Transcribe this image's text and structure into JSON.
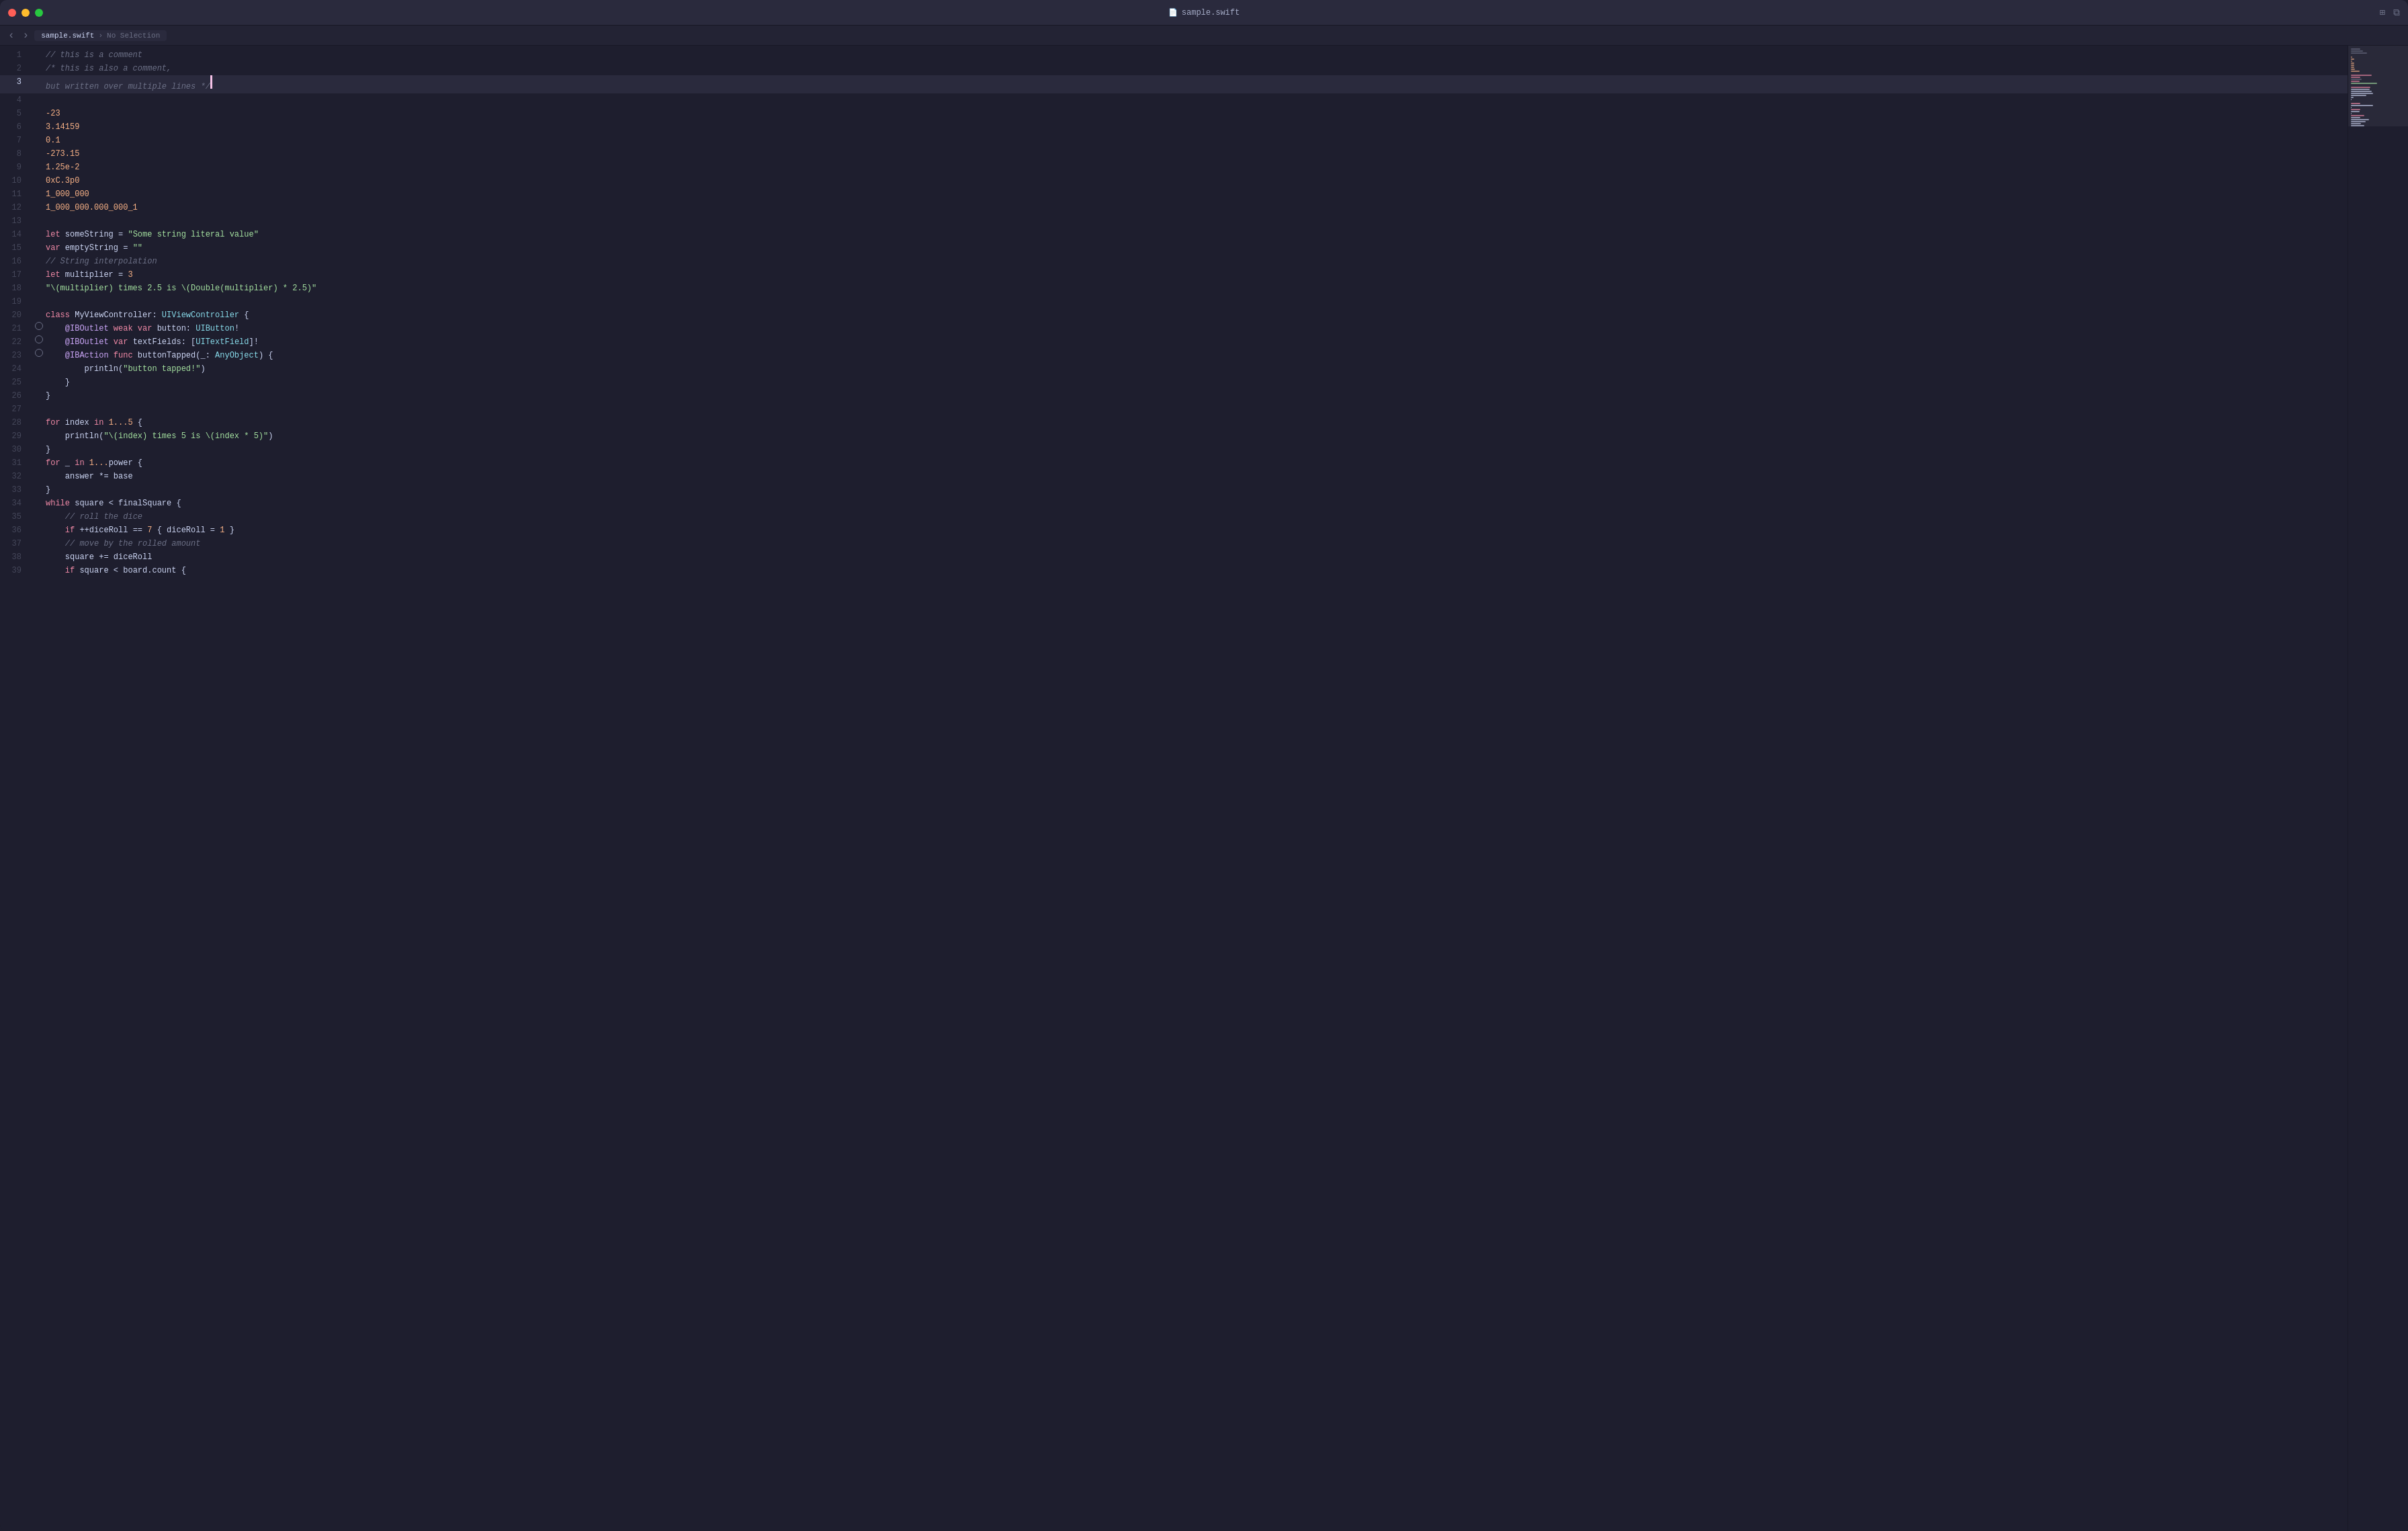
{
  "window": {
    "title": "sample.swift",
    "tab_label": "sample.swift",
    "breadcrumb": "No Selection",
    "traffic_lights": {
      "close": "close",
      "minimize": "minimize",
      "maximize": "maximize"
    }
  },
  "toolbar": {
    "nav_back": "‹",
    "nav_forward": "›",
    "grid_icon": "⊞",
    "split_icon": "⧉"
  },
  "code": {
    "lines": [
      {
        "num": 1,
        "gutter": "",
        "content": "// this is a comment",
        "tokens": [
          {
            "type": "comment",
            "text": "// this is a comment"
          }
        ]
      },
      {
        "num": 2,
        "gutter": "",
        "content": "/* this is also a comment,",
        "tokens": [
          {
            "type": "comment",
            "text": "/* this is also a comment,"
          }
        ]
      },
      {
        "num": 3,
        "gutter": "",
        "content": "but written over multiple lines */",
        "tokens": [
          {
            "type": "comment",
            "text": "but written over multiple lines */"
          }
        ],
        "active": true
      },
      {
        "num": 4,
        "gutter": "",
        "content": "",
        "tokens": []
      },
      {
        "num": 5,
        "gutter": "",
        "content": "-23",
        "tokens": [
          {
            "type": "number",
            "text": "-23"
          }
        ]
      },
      {
        "num": 6,
        "gutter": "",
        "content": "3.14159",
        "tokens": [
          {
            "type": "number",
            "text": "3.14159"
          }
        ]
      },
      {
        "num": 7,
        "gutter": "",
        "content": "0.1",
        "tokens": [
          {
            "type": "number",
            "text": "0.1"
          }
        ]
      },
      {
        "num": 8,
        "gutter": "",
        "content": "-273.15",
        "tokens": [
          {
            "type": "number",
            "text": "-273.15"
          }
        ]
      },
      {
        "num": 9,
        "gutter": "",
        "content": "1.25e-2",
        "tokens": [
          {
            "type": "number",
            "text": "1.25e-2"
          }
        ]
      },
      {
        "num": 10,
        "gutter": "",
        "content": "0xC.3p0",
        "tokens": [
          {
            "type": "number",
            "text": "0xC.3p0"
          }
        ]
      },
      {
        "num": 11,
        "gutter": "",
        "content": "1_000_000",
        "tokens": [
          {
            "type": "number",
            "text": "1_000_000"
          }
        ]
      },
      {
        "num": 12,
        "gutter": "",
        "content": "1_000_000.000_000_1",
        "tokens": [
          {
            "type": "number",
            "text": "1_000_000.000_000_1"
          }
        ]
      },
      {
        "num": 13,
        "gutter": "",
        "content": "",
        "tokens": []
      },
      {
        "num": 14,
        "gutter": "",
        "content": "let someString = \"Some string literal value\"",
        "tokens": [
          {
            "type": "keyword",
            "text": "let"
          },
          {
            "type": "plain",
            "text": " someString = "
          },
          {
            "type": "string",
            "text": "\"Some string literal value\""
          }
        ]
      },
      {
        "num": 15,
        "gutter": "",
        "content": "var emptyString = \"\"",
        "tokens": [
          {
            "type": "keyword",
            "text": "var"
          },
          {
            "type": "plain",
            "text": " emptyString = "
          },
          {
            "type": "string",
            "text": "\"\""
          }
        ]
      },
      {
        "num": 16,
        "gutter": "",
        "content": "// String interpolation",
        "tokens": [
          {
            "type": "comment",
            "text": "// String interpolation"
          }
        ]
      },
      {
        "num": 17,
        "gutter": "",
        "content": "let multiplier = 3",
        "tokens": [
          {
            "type": "keyword",
            "text": "let"
          },
          {
            "type": "plain",
            "text": " multiplier = "
          },
          {
            "type": "number",
            "text": "3"
          }
        ]
      },
      {
        "num": 18,
        "gutter": "",
        "content": "\"\\(multiplier) times 2.5 is \\(Double(multiplier) * 2.5)\"",
        "tokens": [
          {
            "type": "string",
            "text": "\"\\(multiplier) times 2.5 is \\(Double(multiplier) * 2.5)\""
          }
        ]
      },
      {
        "num": 19,
        "gutter": "",
        "content": "",
        "tokens": []
      },
      {
        "num": 20,
        "gutter": "",
        "content": "class MyViewController: UIViewController {",
        "tokens": [
          {
            "type": "keyword",
            "text": "class"
          },
          {
            "type": "plain",
            "text": " MyViewController: "
          },
          {
            "type": "type",
            "text": "UIViewController"
          },
          {
            "type": "plain",
            "text": " {"
          }
        ]
      },
      {
        "num": 21,
        "gutter": "circle",
        "content": "    @IBOutlet weak var button: UIButton!",
        "tokens": [
          {
            "type": "plain",
            "text": "    "
          },
          {
            "type": "attr",
            "text": "@IBOutlet"
          },
          {
            "type": "plain",
            "text": " "
          },
          {
            "type": "keyword",
            "text": "weak"
          },
          {
            "type": "plain",
            "text": " "
          },
          {
            "type": "keyword",
            "text": "var"
          },
          {
            "type": "plain",
            "text": " button: "
          },
          {
            "type": "type",
            "text": "UIButton"
          },
          {
            "type": "plain",
            "text": "!"
          }
        ]
      },
      {
        "num": 22,
        "gutter": "circle",
        "content": "    @IBOutlet var textFields: [UITextField]!",
        "tokens": [
          {
            "type": "plain",
            "text": "    "
          },
          {
            "type": "attr",
            "text": "@IBOutlet"
          },
          {
            "type": "plain",
            "text": " "
          },
          {
            "type": "keyword",
            "text": "var"
          },
          {
            "type": "plain",
            "text": " textFields: ["
          },
          {
            "type": "type",
            "text": "UITextField"
          },
          {
            "type": "plain",
            "text": "]!"
          }
        ]
      },
      {
        "num": 23,
        "gutter": "circle",
        "content": "    @IBAction func buttonTapped(_: AnyObject) {",
        "tokens": [
          {
            "type": "plain",
            "text": "    "
          },
          {
            "type": "attr",
            "text": "@IBAction"
          },
          {
            "type": "plain",
            "text": " "
          },
          {
            "type": "keyword",
            "text": "func"
          },
          {
            "type": "plain",
            "text": " buttonTapped(_: "
          },
          {
            "type": "type",
            "text": "AnyObject"
          },
          {
            "type": "plain",
            "text": ") {"
          }
        ]
      },
      {
        "num": 24,
        "gutter": "",
        "content": "        println(\"button tapped!\")",
        "tokens": [
          {
            "type": "plain",
            "text": "        println("
          },
          {
            "type": "string",
            "text": "\"button tapped!\""
          },
          {
            "type": "plain",
            "text": ")"
          }
        ]
      },
      {
        "num": 25,
        "gutter": "",
        "content": "    }",
        "tokens": [
          {
            "type": "plain",
            "text": "    }"
          }
        ]
      },
      {
        "num": 26,
        "gutter": "",
        "content": "}",
        "tokens": [
          {
            "type": "plain",
            "text": "}"
          }
        ]
      },
      {
        "num": 27,
        "gutter": "",
        "content": "",
        "tokens": []
      },
      {
        "num": 28,
        "gutter": "",
        "content": "for index in 1...5 {",
        "tokens": [
          {
            "type": "keyword",
            "text": "for"
          },
          {
            "type": "plain",
            "text": " index "
          },
          {
            "type": "keyword",
            "text": "in"
          },
          {
            "type": "plain",
            "text": " "
          },
          {
            "type": "number",
            "text": "1...5"
          },
          {
            "type": "plain",
            "text": " {"
          }
        ]
      },
      {
        "num": 29,
        "gutter": "",
        "content": "    println(\"\\(index) times 5 is \\(index * 5)\")",
        "tokens": [
          {
            "type": "plain",
            "text": "    println("
          },
          {
            "type": "string",
            "text": "\"\\(index) times 5 is \\(index * 5)\""
          },
          {
            "type": "plain",
            "text": ")"
          }
        ]
      },
      {
        "num": 30,
        "gutter": "",
        "content": "}",
        "tokens": [
          {
            "type": "plain",
            "text": "}"
          }
        ]
      },
      {
        "num": 31,
        "gutter": "",
        "content": "for _ in 1...power {",
        "tokens": [
          {
            "type": "keyword",
            "text": "for"
          },
          {
            "type": "plain",
            "text": " _ "
          },
          {
            "type": "keyword",
            "text": "in"
          },
          {
            "type": "plain",
            "text": " "
          },
          {
            "type": "number",
            "text": "1..."
          },
          {
            "type": "plain",
            "text": "power {"
          }
        ]
      },
      {
        "num": 32,
        "gutter": "",
        "content": "    answer *= base",
        "tokens": [
          {
            "type": "plain",
            "text": "    answer *= base"
          }
        ]
      },
      {
        "num": 33,
        "gutter": "",
        "content": "}",
        "tokens": [
          {
            "type": "plain",
            "text": "}"
          }
        ]
      },
      {
        "num": 34,
        "gutter": "",
        "content": "while square < finalSquare {",
        "tokens": [
          {
            "type": "keyword",
            "text": "while"
          },
          {
            "type": "plain",
            "text": " square < finalSquare {"
          }
        ]
      },
      {
        "num": 35,
        "gutter": "",
        "content": "    // roll the dice",
        "tokens": [
          {
            "type": "plain",
            "text": "    "
          },
          {
            "type": "comment",
            "text": "// roll the dice"
          }
        ]
      },
      {
        "num": 36,
        "gutter": "",
        "content": "    if ++diceRoll == 7 { diceRoll = 1 }",
        "tokens": [
          {
            "type": "plain",
            "text": "    "
          },
          {
            "type": "keyword",
            "text": "if"
          },
          {
            "type": "plain",
            "text": " ++diceRoll == "
          },
          {
            "type": "number",
            "text": "7"
          },
          {
            "type": "plain",
            "text": " { diceRoll = "
          },
          {
            "type": "number",
            "text": "1"
          },
          {
            "type": "plain",
            "text": " }"
          }
        ]
      },
      {
        "num": 37,
        "gutter": "",
        "content": "    // move by the rolled amount",
        "tokens": [
          {
            "type": "plain",
            "text": "    "
          },
          {
            "type": "comment",
            "text": "// move by the rolled amount"
          }
        ]
      },
      {
        "num": 38,
        "gutter": "",
        "content": "    square += diceRoll",
        "tokens": [
          {
            "type": "plain",
            "text": "    square += diceRoll"
          }
        ]
      },
      {
        "num": 39,
        "gutter": "",
        "content": "    if square < board.count {",
        "tokens": [
          {
            "type": "plain",
            "text": "    "
          },
          {
            "type": "keyword",
            "text": "if"
          },
          {
            "type": "plain",
            "text": " square < board.count {"
          }
        ]
      }
    ]
  },
  "colors": {
    "bg": "#1e1e2e",
    "active_line": "#2a2a3d",
    "comment": "#6c7086",
    "number": "#fab387",
    "string": "#a6e3a1",
    "keyword": "#f38ba8",
    "type": "#89dceb",
    "attr": "#cba6f7",
    "plain": "#cdd6f4"
  }
}
